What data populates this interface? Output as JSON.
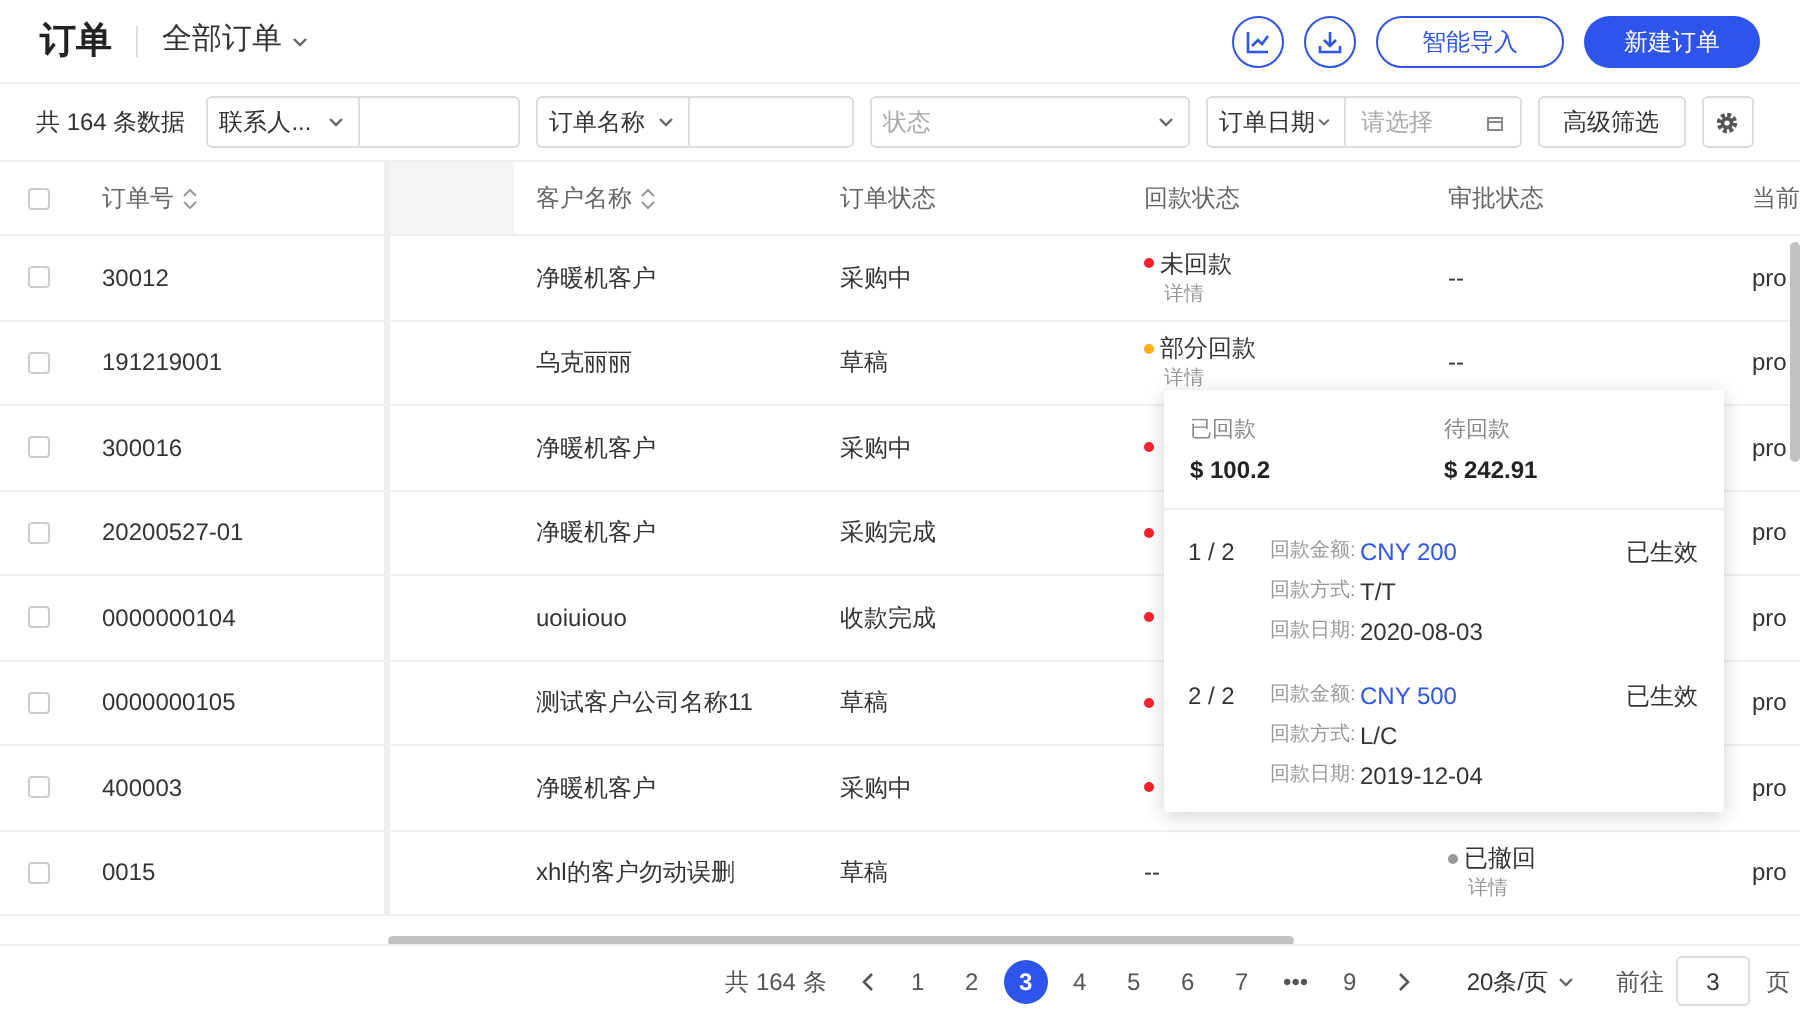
{
  "header": {
    "title": "订单",
    "view": "全部订单",
    "buttons": [
      {
        "kind": "chart"
      },
      {
        "kind": "download"
      },
      {
        "kind": "outline",
        "label": "智能导入"
      },
      {
        "kind": "primary",
        "label": "新建订单"
      }
    ]
  },
  "filters": {
    "total": "共 164 条数据",
    "contact": "联系人...",
    "order_name": "订单名称",
    "status_placeholder": "状态",
    "date": "订单日期",
    "date_placeholder": "请选择",
    "advanced": "高级筛选"
  },
  "table": {
    "all_checked": false,
    "columns": [
      {
        "label": "订单号",
        "sortable": true
      },
      {
        "label": "客户名称",
        "sortable": true
      },
      {
        "label": "订单状态",
        "sortable": false
      },
      {
        "label": "回款状态",
        "sortable": false
      },
      {
        "label": "审批状态",
        "sortable": false
      },
      {
        "label": "当前",
        "sortable": false
      }
    ],
    "rows": [
      {
        "checked": false,
        "order_no": "30012",
        "customer": "净暖机客户",
        "status": "采购中",
        "payment": {
          "color": "#f5222d",
          "text": "未回款",
          "detail": "详情"
        },
        "approval": {
          "text": "--"
        },
        "current": "pro"
      },
      {
        "checked": false,
        "order_no": "191219001",
        "customer": "乌克丽丽",
        "status": "草稿",
        "payment": {
          "color": "#faad14",
          "text": "部分回款",
          "detail": "详情"
        },
        "approval": {
          "text": "--"
        },
        "current": "pro"
      },
      {
        "checked": false,
        "order_no": "300016",
        "customer": "净暖机客户",
        "status": "采购中",
        "payment": {
          "color": "#f5222d"
        },
        "approval": {},
        "current": "pro"
      },
      {
        "checked": false,
        "order_no": "20200527-01",
        "customer": "净暖机客户",
        "status": "采购完成",
        "payment": {
          "color": "#f5222d"
        },
        "approval": {},
        "current": "pro"
      },
      {
        "checked": false,
        "order_no": "0000000104",
        "customer": "uoiuiouo",
        "status": "收款完成",
        "payment": {
          "color": "#f5222d"
        },
        "approval": {},
        "current": "pro"
      },
      {
        "checked": false,
        "order_no": "0000000105",
        "customer": "测试客户公司名称11",
        "status": "草稿",
        "payment": {
          "color": "#f5222d"
        },
        "approval": {},
        "current": "pro"
      },
      {
        "checked": false,
        "order_no": "400003",
        "customer": "净暖机客户",
        "status": "采购中",
        "payment": {
          "color": "#f5222d"
        },
        "approval": {},
        "current": "pro"
      },
      {
        "checked": false,
        "order_no": "0015",
        "customer": "xhl的客户勿动误删",
        "status": "草稿",
        "payment": {
          "text": "--"
        },
        "approval": {
          "color": "#999999",
          "text": "已撤回",
          "detail": "详情"
        },
        "current": "pro"
      }
    ]
  },
  "popover": {
    "received_label": "已回款",
    "received": "$ 100.2",
    "pending_label": "待回款",
    "pending": "$ 242.91",
    "records": [
      {
        "index": "1 / 2",
        "status": "已生效",
        "fields": [
          {
            "label": "回款金额:",
            "value": "CNY 200",
            "kind": "link"
          },
          {
            "label": "回款方式:",
            "value": "T/T",
            "kind": "text"
          },
          {
            "label": "回款日期:",
            "value": "2020-08-03",
            "kind": "text"
          }
        ]
      },
      {
        "index": "2 / 2",
        "status": "已生效",
        "fields": [
          {
            "label": "回款金额:",
            "value": "CNY 500",
            "kind": "link"
          },
          {
            "label": "回款方式:",
            "value": "L/C",
            "kind": "text"
          },
          {
            "label": "回款日期:",
            "value": "2019-12-04",
            "kind": "text"
          }
        ]
      }
    ]
  },
  "pagination": {
    "total": "共 164 条",
    "pages": [
      {
        "label": "1",
        "selected": false
      },
      {
        "label": "2",
        "selected": false
      },
      {
        "label": "3",
        "selected": true
      },
      {
        "label": "4",
        "selected": false
      },
      {
        "label": "5",
        "selected": false
      },
      {
        "label": "6",
        "selected": false
      },
      {
        "label": "7",
        "selected": false
      },
      {
        "label": "•••",
        "selected": false
      },
      {
        "label": "9",
        "selected": false
      }
    ],
    "page_size": "20条/页",
    "goto_label": "前往",
    "goto_value": "3",
    "page_unit": "页"
  }
}
